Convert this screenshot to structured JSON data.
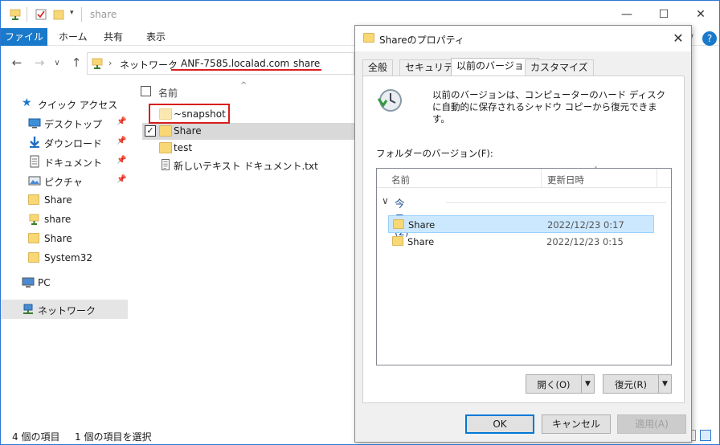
{
  "window": {
    "title": "share",
    "minimize_glyph": "—",
    "maximize_glyph": "☐",
    "close_glyph": "✕"
  },
  "ribbon": {
    "tabs": [
      "ファイル",
      "ホーム",
      "共有",
      "表示"
    ]
  },
  "address": {
    "segments": [
      "ネットワーク",
      "ANF-7585.localad.com",
      "share"
    ]
  },
  "nav": {
    "items": [
      {
        "label": "クイック アクセス",
        "icon": "star-icon",
        "pinned": false
      },
      {
        "label": "デスクトップ",
        "icon": "desktop-icon",
        "pinned": true
      },
      {
        "label": "ダウンロード",
        "icon": "download-icon",
        "pinned": true
      },
      {
        "label": "ドキュメント",
        "icon": "document-icon",
        "pinned": true
      },
      {
        "label": "ピクチャ",
        "icon": "picture-icon",
        "pinned": true
      },
      {
        "label": "Share",
        "icon": "folder-icon",
        "pinned": false
      },
      {
        "label": "share",
        "icon": "network-folder-icon",
        "pinned": false
      },
      {
        "label": "Share",
        "icon": "folder-icon",
        "pinned": false
      },
      {
        "label": "System32",
        "icon": "folder-icon",
        "pinned": false
      },
      {
        "label": "PC",
        "icon": "pc-icon",
        "pinned": false
      },
      {
        "label": "ネットワーク",
        "icon": "network-icon",
        "pinned": false
      }
    ]
  },
  "files": {
    "column_name": "名前",
    "rows": [
      {
        "name": "~snapshot",
        "type": "folder",
        "hidden": true,
        "checked": false,
        "selected": false
      },
      {
        "name": "Share",
        "type": "folder",
        "hidden": false,
        "checked": true,
        "selected": true
      },
      {
        "name": "test",
        "type": "folder",
        "hidden": false,
        "checked": false,
        "selected": false
      },
      {
        "name": "新しいテキスト ドキュメント.txt",
        "type": "text",
        "hidden": false,
        "checked": false,
        "selected": false
      }
    ]
  },
  "status": {
    "item_count": "4 個の項目",
    "selected_count": "1 個の項目を選択"
  },
  "dialog": {
    "title": "Shareのプロパティ",
    "tabs": [
      "全般",
      "セキュリティ",
      "以前のバージョン",
      "カスタマイズ"
    ],
    "active_tab": 2,
    "description": "以前のバージョンは、コンピューターのハード ディスクに自動的に保存されるシャドウ コピーから復元できます。",
    "folder_versions_label": "フォルダーのバージョン(F):",
    "columns": {
      "name": "名前",
      "modified": "更新日時"
    },
    "group_label": "今日 (2)",
    "versions": [
      {
        "name": "Share",
        "date": "2022/12/23 0:17",
        "selected": true
      },
      {
        "name": "Share",
        "date": "2022/12/23 0:15",
        "selected": false
      }
    ],
    "open_button": "開く(O)",
    "restore_button": "復元(R)",
    "ok_button": "OK",
    "cancel_button": "キャンセル",
    "apply_button": "適用(A)"
  },
  "colors": {
    "accent": "#1979ca",
    "highlight_red": "#d81e1e",
    "folder": "#f8d775"
  }
}
